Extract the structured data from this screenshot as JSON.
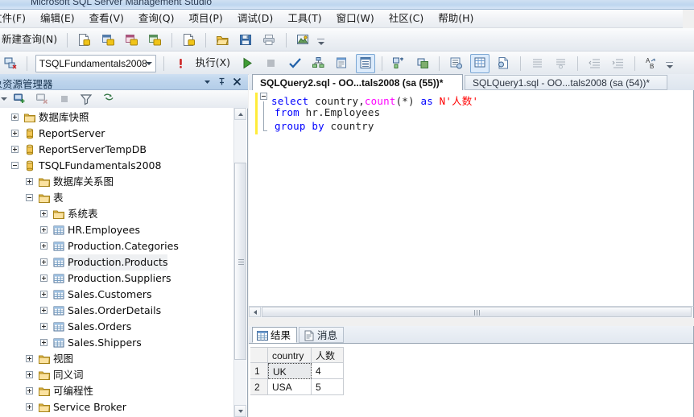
{
  "window": {
    "title": "Microsoft SQL Server Management Studio"
  },
  "menu": {
    "items": [
      {
        "label": "文件(F)",
        "name": "menu-file"
      },
      {
        "label": "编辑(E)",
        "name": "menu-edit"
      },
      {
        "label": "查看(V)",
        "name": "menu-view"
      },
      {
        "label": "查询(Q)",
        "name": "menu-query"
      },
      {
        "label": "项目(P)",
        "name": "menu-project"
      },
      {
        "label": "调试(D)",
        "name": "menu-debug"
      },
      {
        "label": "工具(T)",
        "name": "menu-tools"
      },
      {
        "label": "窗口(W)",
        "name": "menu-window"
      },
      {
        "label": "社区(C)",
        "name": "menu-community"
      },
      {
        "label": "帮助(H)",
        "name": "menu-help"
      }
    ]
  },
  "toolbar1": {
    "new_query_label": "新建查询(N)",
    "icons": [
      "new-query-icon",
      "database-engine-query-icon",
      "analysis-services-mdx-query-icon",
      "analysis-services-dmx-query-icon",
      "analysis-services-xmla-query-icon",
      "new-file-icon",
      "open-file-icon",
      "save-icon",
      "print-icon",
      "summary-icon"
    ]
  },
  "toolbar2": {
    "connect_icon": "connect-object-explorer-icon",
    "database_combo_value": "TSQLFundamentals2008",
    "execute_label": "执行(X)",
    "icons": [
      "debug-icon",
      "play-icon",
      "stop-icon",
      "parse-check-icon",
      "display-estimated-plan-icon",
      "query-options-icon",
      "include-actual-plan-icon",
      "include-client-statistics-icon",
      "results-to-grid-icon",
      "results-to-text-icon",
      "results-to-file-icon",
      "comment-icon",
      "uncomment-icon",
      "decrease-indent-icon",
      "increase-indent-icon",
      "spell-check-icon"
    ]
  },
  "object_explorer": {
    "title": "对象资源管理器",
    "title_icons": [
      "chevron-down-icon",
      "pin-icon",
      "close-icon"
    ],
    "toolbar_icons": [
      "connect-icon",
      "disconnect-icon",
      "stop-icon",
      "filter-icon",
      "refresh-icon"
    ],
    "tree": [
      {
        "label": "数据库快照",
        "icon": "folder-icon",
        "depth": 1,
        "state": "collapsed",
        "highlight": false
      },
      {
        "label": "ReportServer",
        "icon": "database-icon",
        "depth": 1,
        "state": "collapsed",
        "highlight": false
      },
      {
        "label": "ReportServerTempDB",
        "icon": "database-icon",
        "depth": 1,
        "state": "collapsed",
        "highlight": false
      },
      {
        "label": "TSQLFundamentals2008",
        "icon": "database-icon",
        "depth": 1,
        "state": "expanded",
        "highlight": false
      },
      {
        "label": "数据库关系图",
        "icon": "folder-icon",
        "depth": 2,
        "state": "collapsed",
        "highlight": false
      },
      {
        "label": "表",
        "icon": "folder-icon",
        "depth": 2,
        "state": "expanded",
        "highlight": false
      },
      {
        "label": "系统表",
        "icon": "folder-icon",
        "depth": 3,
        "state": "collapsed",
        "highlight": false
      },
      {
        "label": "HR.Employees",
        "icon": "table-icon",
        "depth": 3,
        "state": "collapsed",
        "highlight": false
      },
      {
        "label": "Production.Categories",
        "icon": "table-icon",
        "depth": 3,
        "state": "collapsed",
        "highlight": false
      },
      {
        "label": "Production.Products",
        "icon": "table-icon",
        "depth": 3,
        "state": "collapsed",
        "highlight": true
      },
      {
        "label": "Production.Suppliers",
        "icon": "table-icon",
        "depth": 3,
        "state": "collapsed",
        "highlight": false
      },
      {
        "label": "Sales.Customers",
        "icon": "table-icon",
        "depth": 3,
        "state": "collapsed",
        "highlight": false
      },
      {
        "label": "Sales.OrderDetails",
        "icon": "table-icon",
        "depth": 3,
        "state": "collapsed",
        "highlight": false
      },
      {
        "label": "Sales.Orders",
        "icon": "table-icon",
        "depth": 3,
        "state": "collapsed",
        "highlight": false
      },
      {
        "label": "Sales.Shippers",
        "icon": "table-icon",
        "depth": 3,
        "state": "collapsed",
        "highlight": false
      },
      {
        "label": "视图",
        "icon": "folder-icon",
        "depth": 2,
        "state": "collapsed",
        "highlight": false
      },
      {
        "label": "同义词",
        "icon": "folder-icon",
        "depth": 2,
        "state": "collapsed",
        "highlight": false
      },
      {
        "label": "可编程性",
        "icon": "folder-icon",
        "depth": 2,
        "state": "collapsed",
        "highlight": false
      },
      {
        "label": "Service Broker",
        "icon": "folder-icon",
        "depth": 2,
        "state": "collapsed",
        "highlight": false
      }
    ]
  },
  "editor": {
    "tabs": [
      {
        "label": "SQLQuery2.sql - OO...tals2008 (sa (55))*",
        "active": true
      },
      {
        "label": "SQLQuery1.sql - OO...tals2008 (sa (54))*",
        "active": false
      }
    ],
    "code_lines": [
      [
        {
          "t": "select",
          "c": "kw"
        },
        {
          "t": " ",
          "c": "id"
        },
        {
          "t": "country",
          "c": "id"
        },
        {
          "t": ",",
          "c": "pn"
        },
        {
          "t": "count",
          "c": "fn"
        },
        {
          "t": "(*) ",
          "c": "pn"
        },
        {
          "t": "as",
          "c": "kw"
        },
        {
          "t": " ",
          "c": "id"
        },
        {
          "t": "N'人数'",
          "c": "lit"
        }
      ],
      [
        {
          "t": "from",
          "c": "kw"
        },
        {
          "t": " hr.Employees",
          "c": "id"
        }
      ],
      [
        {
          "t": "group",
          "c": "kw"
        },
        {
          "t": " ",
          "c": "id"
        },
        {
          "t": "by",
          "c": "kw"
        },
        {
          "t": " country",
          "c": "id"
        }
      ]
    ],
    "plain_text": "select country,count(*) as N'人数'\nfrom hr.Employees\ngroup by country"
  },
  "results": {
    "tabs": [
      {
        "label": "结果",
        "icon": "grid-icon",
        "active": true
      },
      {
        "label": "消息",
        "icon": "message-icon",
        "active": false
      }
    ],
    "columns": [
      "country",
      "人数"
    ],
    "rows": [
      {
        "num": "1",
        "country": "UK",
        "count": "4"
      },
      {
        "num": "2",
        "country": "USA",
        "count": "5"
      }
    ],
    "selected_cell": "UK"
  },
  "colors": {
    "keyword": "#0000ff",
    "function": "#ff00ff",
    "string_literal": "#ff0000",
    "titlebar": "#bed6ef",
    "panel_header": "#bdd4ec"
  }
}
